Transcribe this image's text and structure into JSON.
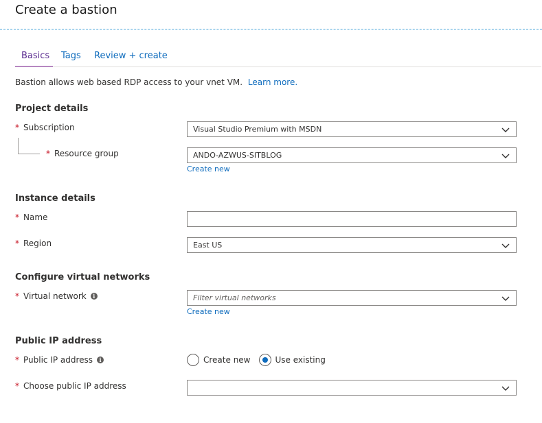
{
  "page": {
    "title": "Create a bastion"
  },
  "tabs": [
    {
      "label": "Basics",
      "active": true
    },
    {
      "label": "Tags",
      "active": false
    },
    {
      "label": "Review + create",
      "active": false
    }
  ],
  "intro": {
    "text": "Bastion allows web based RDP access to your vnet VM.",
    "link": "Learn more."
  },
  "required_marker": "*",
  "info_glyph": "i",
  "project": {
    "heading": "Project details",
    "subscription": {
      "label": "Subscription",
      "value": "Visual Studio Premium with MSDN"
    },
    "resource_group": {
      "label": "Resource group",
      "value": "ANDO-AZWUS-SITBLOG",
      "create_new": "Create new"
    }
  },
  "instance": {
    "heading": "Instance details",
    "name": {
      "label": "Name",
      "value": ""
    },
    "region": {
      "label": "Region",
      "value": "East US"
    }
  },
  "vnet": {
    "heading": "Configure virtual networks",
    "virtual_network": {
      "label": "Virtual network",
      "placeholder": "Filter virtual networks",
      "create_new": "Create new"
    }
  },
  "public_ip": {
    "heading": "Public IP address",
    "public_ip_address": {
      "label": "Public IP address",
      "options": [
        "Create new",
        "Use existing"
      ],
      "selected": "Use existing"
    },
    "choose": {
      "label": "Choose public IP address",
      "value": ""
    }
  },
  "colors": {
    "accent": "#0f6cbd",
    "tab_active": "#8b2fa5",
    "required": "#c50f1f",
    "dashed_divider": "#46a3d9"
  }
}
